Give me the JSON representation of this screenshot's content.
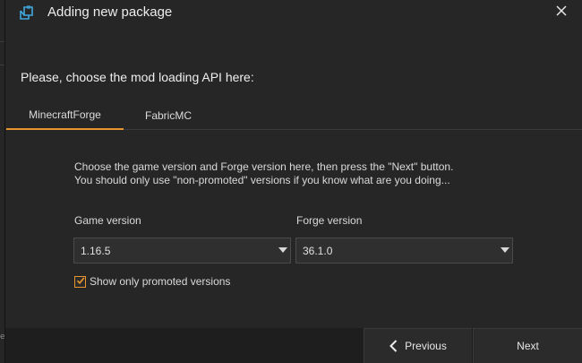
{
  "window": {
    "title": "Adding new package",
    "app_icon": "package-icon",
    "close_icon": "close-icon"
  },
  "edge_fragment": "e",
  "prompt": "Please, choose the mod loading API here:",
  "tabs": [
    {
      "label": "MinecraftForge",
      "active": true
    },
    {
      "label": "FabricMC",
      "active": false
    }
  ],
  "instructions": {
    "line1": "Choose the game version and Forge version here, then press the \"Next\" button.",
    "line2": "You should only use \"non-promoted\" versions if you know what are you doing..."
  },
  "game_version": {
    "label": "Game version",
    "value": "1.16.5"
  },
  "forge_version": {
    "label": "Forge version",
    "value": "36.1.0"
  },
  "promoted_checkbox": {
    "label": "Show only promoted versions",
    "checked": true
  },
  "footer": {
    "previous_label": "Previous",
    "next_label": "Next"
  },
  "colors": {
    "accent": "#e8942e",
    "background": "#262626",
    "text": "#e6e6e6"
  }
}
